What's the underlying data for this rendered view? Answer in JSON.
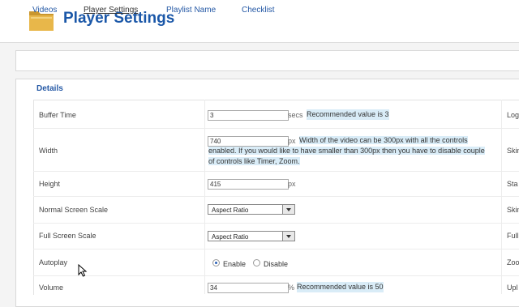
{
  "header": {
    "title": "Player Settings",
    "icon": "folder-icon"
  },
  "tabs": [
    {
      "label": "Videos"
    },
    {
      "label": "Player Settings",
      "active": true
    },
    {
      "label": "Playlist Name"
    },
    {
      "label": "Checklist"
    }
  ],
  "details": {
    "legend": "Details",
    "rows": {
      "buffer": {
        "label": "Buffer Time",
        "value": "3",
        "unit": "secs",
        "hint": "Recommended value is 3"
      },
      "width": {
        "label": "Width",
        "value": "740",
        "unit": "px",
        "hint": "Width of the video can be 300px with all the controls enabled. If you would like to have smaller than 300px then you have to disable couple of controls like Timer, Zoom."
      },
      "height": {
        "label": "Height",
        "value": "415",
        "unit": "px"
      },
      "normal_scale": {
        "label": "Normal Screen Scale",
        "value": "Aspect Ratio"
      },
      "full_scale": {
        "label": "Full Screen Scale",
        "value": "Aspect Ratio"
      },
      "autoplay": {
        "label": "Autoplay",
        "enable": "Enable",
        "disable": "Disable",
        "selected": "Enable"
      },
      "volume": {
        "label": "Volume",
        "value": "34",
        "unit": "%",
        "hint": "Recommended value is 50"
      }
    }
  },
  "right_column": [
    "Log",
    "Skin",
    "Sta",
    "Skin",
    "Full",
    "Zoo",
    "Upl"
  ],
  "colors": {
    "accent": "#1a57a8",
    "link": "#2458a5",
    "hint_bg": "#d9ecf7"
  }
}
